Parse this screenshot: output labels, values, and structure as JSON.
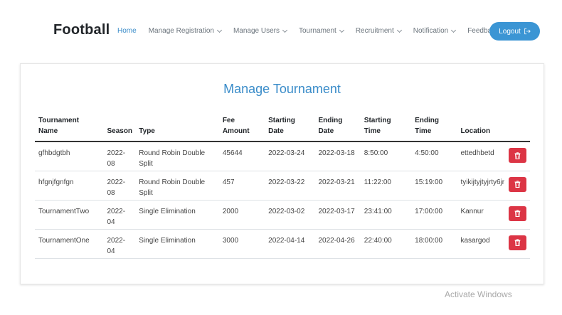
{
  "brand": "Football",
  "nav": {
    "home": "Home",
    "manage_registration": "Manage Registration",
    "manage_users": "Manage Users",
    "tournament": "Tournament",
    "recruitment": "Recruitment",
    "notification": "Notification",
    "feedbacks": "Feedbacks"
  },
  "logout_label": "Logout",
  "page_title": "Manage Tournament",
  "table": {
    "headers": {
      "name": [
        "Tournament",
        "Name"
      ],
      "season": "Season",
      "type": "Type",
      "fee": [
        "Fee",
        "Amount"
      ],
      "start_date": [
        "Starting",
        "Date"
      ],
      "end_date": [
        "Ending",
        "Date"
      ],
      "start_time": [
        "Starting",
        "Time"
      ],
      "end_time": [
        "Ending",
        "Time"
      ],
      "location": "Location"
    },
    "rows": [
      {
        "name": "gfhbdgtbh",
        "season": [
          "2022-",
          "08"
        ],
        "type": [
          "Round Robin Double",
          "Split"
        ],
        "fee": "45644",
        "start_date": "2022-03-24",
        "end_date": "2022-03-18",
        "start_time": "8:50:00",
        "end_time": "4:50:00",
        "location": "ettedhbetd"
      },
      {
        "name": "hfgnjfgnfgn",
        "season": [
          "2022-",
          "08"
        ],
        "type": [
          "Round Robin Double",
          "Split"
        ],
        "fee": "457",
        "start_date": "2022-03-22",
        "end_date": "2022-03-21",
        "start_time": "11:22:00",
        "end_time": "15:19:00",
        "location": "tyikijtyjtyjrty6jr"
      },
      {
        "name": "TournamentTwo",
        "season": [
          "2022-",
          "04"
        ],
        "type": [
          "Single Elimination",
          ""
        ],
        "fee": "2000",
        "start_date": "2022-03-02",
        "end_date": "2022-03-17",
        "start_time": "23:41:00",
        "end_time": "17:00:00",
        "location": "Kannur"
      },
      {
        "name": "TournamentOne",
        "season": [
          "2022-",
          "04"
        ],
        "type": [
          "Single Elimination",
          ""
        ],
        "fee": "3000",
        "start_date": "2022-04-14",
        "end_date": "2022-04-26",
        "start_time": "22:40:00",
        "end_time": "18:00:00",
        "location": "kasargod"
      }
    ]
  },
  "watermark": "Activate Windows",
  "colors": {
    "accent": "#3a8cc9",
    "logout_bg": "#3b95d4",
    "delete_bg": "#dc3545"
  },
  "icons": {
    "logout": "logout-icon",
    "delete": "trash-icon",
    "dropdown": "chevron-down-icon"
  }
}
